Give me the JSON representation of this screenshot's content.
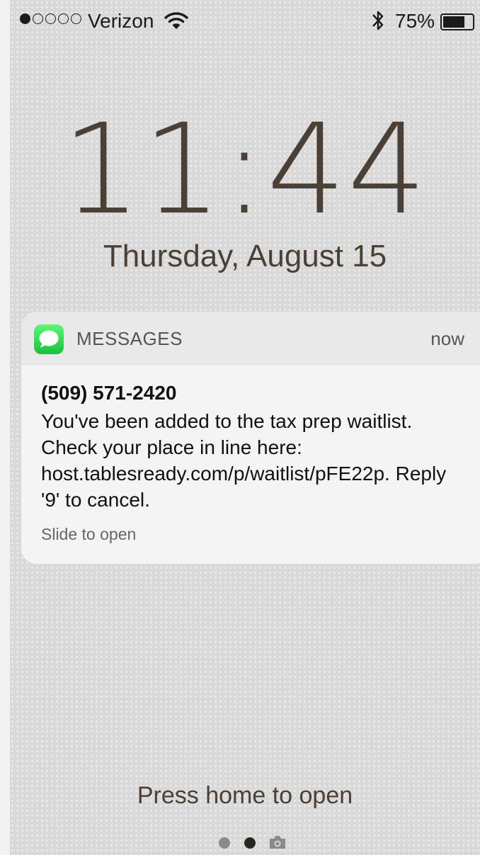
{
  "status_bar": {
    "signal_filled": 1,
    "signal_total": 5,
    "carrier": "Verizon",
    "battery_percent": "75%",
    "battery_level": 0.75,
    "icons": [
      "wifi-icon",
      "bluetooth-icon",
      "battery-icon"
    ]
  },
  "lock_screen": {
    "time": "11:44",
    "date": "Thursday, August 15"
  },
  "notification": {
    "app_name": "MESSAGES",
    "time": "now",
    "sender": "(509) 571-2420",
    "body": "You've been added to the tax prep waitlist. Check your place in line here: host.tablesready.com/p/waitlist/pFE22p. Reply '9' to cancel.",
    "hint": "Slide to open",
    "app_icon": "messages-icon",
    "app_icon_color": "#2dd24f"
  },
  "footer": {
    "press_home": "Press home to open",
    "pages": 2,
    "active_page": 2,
    "camera_icon": "camera-icon"
  },
  "colors": {
    "text_brown": "#4a4036",
    "background": "#d9d9d9"
  }
}
